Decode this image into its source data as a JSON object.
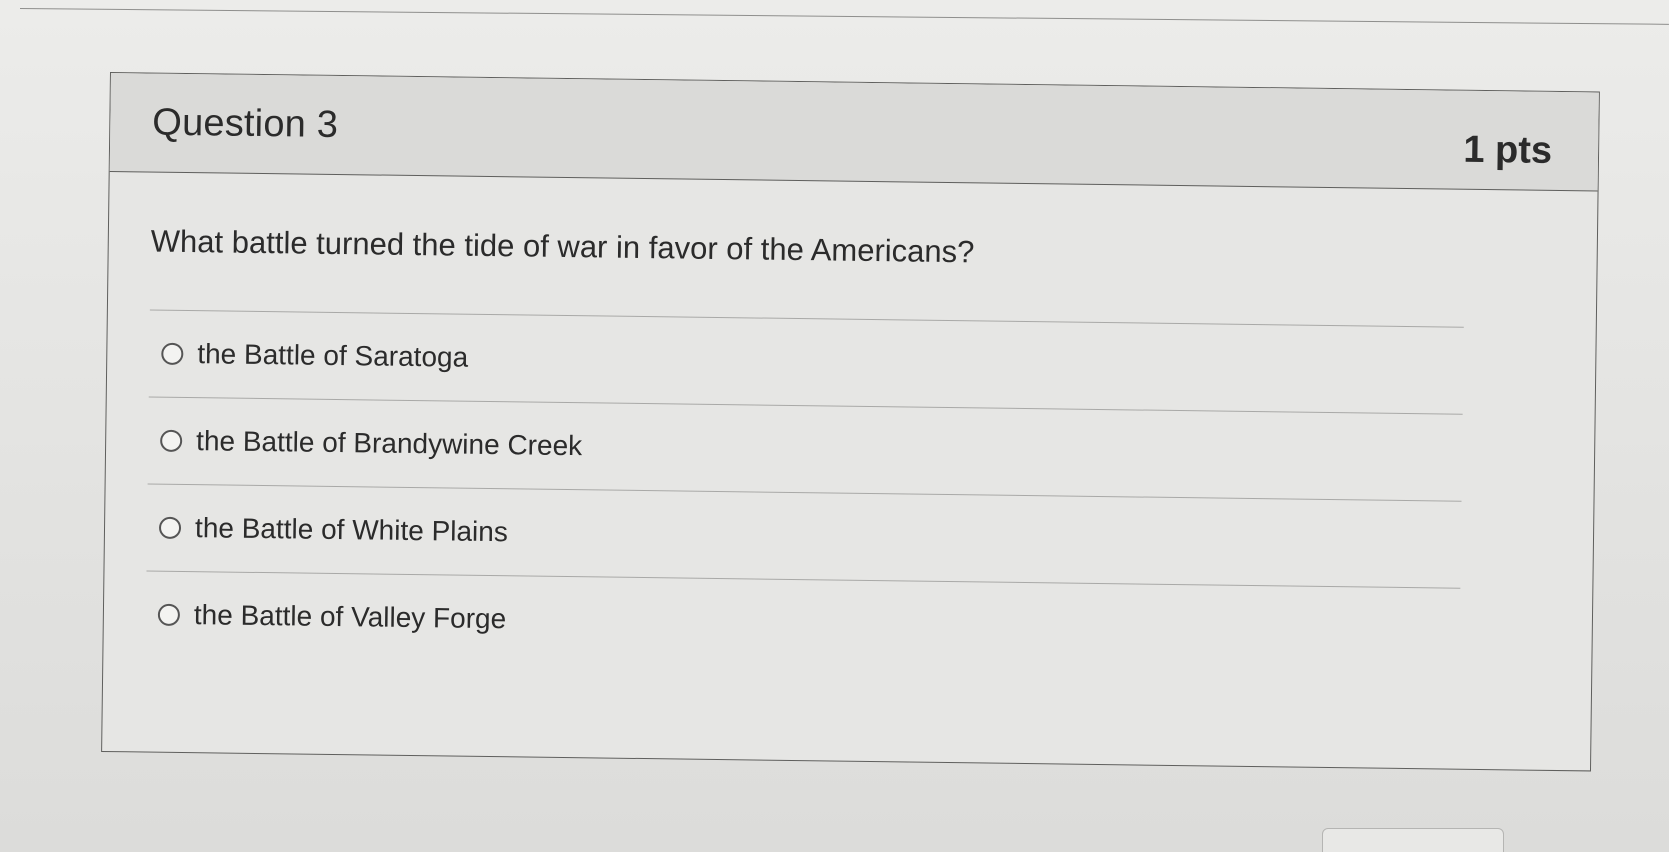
{
  "question": {
    "title": "Question 3",
    "points": "1 pts",
    "text": "What battle turned the tide of war in favor of the Americans?",
    "answers": [
      {
        "label": "the Battle of Saratoga"
      },
      {
        "label": "the Battle of Brandywine Creek"
      },
      {
        "label": "the Battle of White Plains"
      },
      {
        "label": "the Battle of Valley Forge"
      }
    ]
  },
  "colors": {
    "background": "#e2e2e0",
    "card": "#e6e6e4",
    "header": "#dadad8",
    "border": "#5f5f5d",
    "text": "#2b2b2b"
  }
}
